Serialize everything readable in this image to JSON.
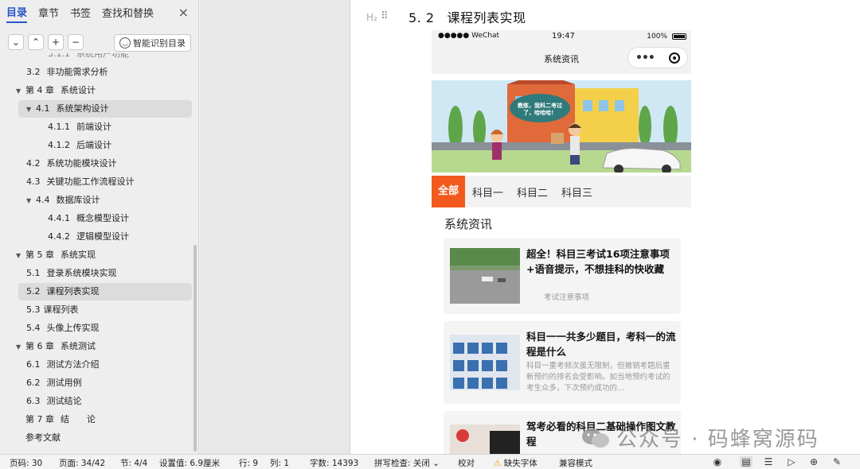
{
  "nav": {
    "tabs": [
      {
        "label": "目录",
        "active": true
      },
      {
        "label": "章节"
      },
      {
        "label": "书签"
      },
      {
        "label": "查找和替换"
      }
    ],
    "close_icon": "×",
    "toolbar": {
      "collapse": "⌄",
      "expand": "⌃",
      "add": "+",
      "remove": "−",
      "smart_label": "智能识别目录"
    },
    "toc": [
      {
        "num": "3.1.1",
        "text": "系统用户功能",
        "level": 3,
        "partial": true
      },
      {
        "num": "3.2",
        "text": "非功能需求分析",
        "level": 2
      },
      {
        "num": "第 4 章",
        "text": "系统设计",
        "level": 1,
        "expanded": true
      },
      {
        "num": "4.1",
        "text": "系统架构设计",
        "level": 2,
        "expanded": true,
        "selected": true
      },
      {
        "num": "4.1.1",
        "text": "前端设计",
        "level": 3
      },
      {
        "num": "4.1.2",
        "text": "后端设计",
        "level": 3
      },
      {
        "num": "4.2",
        "text": "系统功能模块设计",
        "level": 2
      },
      {
        "num": "4.3",
        "text": "关键功能工作流程设计",
        "level": 2
      },
      {
        "num": "4.4",
        "text": "数据库设计",
        "level": 2,
        "expanded": true
      },
      {
        "num": "4.4.1",
        "text": "概念模型设计",
        "level": 3
      },
      {
        "num": "4.4.2",
        "text": "逻辑模型设计",
        "level": 3
      },
      {
        "num": "第 5 章",
        "text": "系统实现",
        "level": 1,
        "expanded": true
      },
      {
        "num": "5.1",
        "text": "登录系统模块实现",
        "level": 2
      },
      {
        "num": "5.2",
        "text": "课程列表实现",
        "level": 2,
        "selected": true
      },
      {
        "num": "5.3",
        "text": "课程列表",
        "level": 2,
        "tight": true
      },
      {
        "num": "5.4",
        "text": "头像上传实现",
        "level": 2
      },
      {
        "num": "第 6 章",
        "text": "系统测试",
        "level": 1,
        "expanded": true
      },
      {
        "num": "6.1",
        "text": "测试方法介绍",
        "level": 2
      },
      {
        "num": "6.2",
        "text": "测试用例",
        "level": 2
      },
      {
        "num": "6.3",
        "text": "测试结论",
        "level": 2
      },
      {
        "num": "第 7 章",
        "text": "结　　论",
        "level": 1
      },
      {
        "num": "",
        "text": "参考文献",
        "level": 1
      }
    ]
  },
  "document": {
    "h2_mark": "H₂",
    "drag_icon": "⠿",
    "heading_num": "5. 2",
    "heading_text": "课程列表实现"
  },
  "phone": {
    "signal": "●●●●● WeChat",
    "time": "19:47",
    "battery": "100%",
    "title": "系统资讯",
    "banner_speech": "教练，我科二考过了，哈哈哈！",
    "tabs": [
      "全部",
      "科目一",
      "科目二",
      "科目三"
    ],
    "active_tab": "全部",
    "news_title": "系统资讯",
    "cards": [
      {
        "title": "超全！科目三考试16项注意事项+语音提示，不想挂科的快收藏",
        "subtitle": "考试注意事项"
      },
      {
        "title": "科目一一共多少题目，考科一的流程是什么",
        "subtitle": "科目一重考频次虽无限制，但撤销考题后重新预约的排名会受影响。如当地预约考试的考生众多，下次预约成功的..."
      },
      {
        "title": "驾考必看的科目二基础操作图文教程",
        "subtitle": ""
      }
    ]
  },
  "watermark": "公众号 · 码蜂窝源码",
  "statusbar": {
    "page_code": "页码: 30",
    "pages": "页面: 34/42",
    "section": "节: 4/4",
    "setting": "设置值: 6.9厘米",
    "row": "行: 9",
    "col": "列: 1",
    "words": "字数: 14393",
    "spell": "拼写检查: 关闭",
    "proof": "校对",
    "missing_font": "缺失字体",
    "compat": "兼容模式"
  },
  "colors": {
    "accent": "#2a55c9",
    "tab_active": "#f25a1d"
  }
}
